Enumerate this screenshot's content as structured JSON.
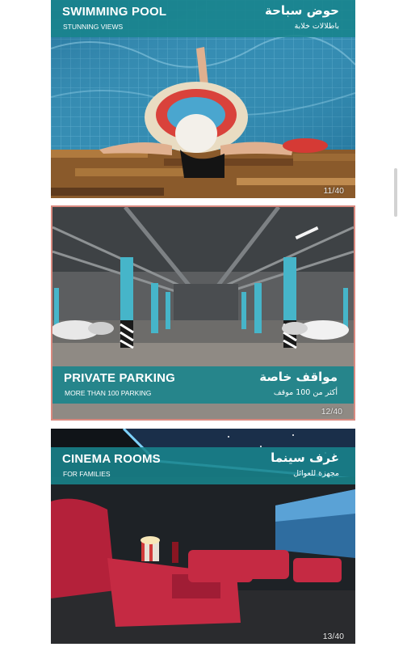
{
  "slides": [
    {
      "title_en": "SWIMMING POOL",
      "subtitle_en": "STUNNING VIEWS",
      "title_ar": "حوض سباحة",
      "subtitle_ar": "باطلالات خلابة",
      "counter": "11/40"
    },
    {
      "title_en": "PRIVATE PARKING",
      "subtitle_en": "MORE THAN 100 PARKING",
      "title_ar": "مواقف خاصة",
      "subtitle_ar": "أكثر من 100 موقف",
      "counter": "12/40"
    },
    {
      "title_en": "CINEMA ROOMS",
      "subtitle_en": "FOR FAMILIES",
      "title_ar": "غرف سينما",
      "subtitle_ar": "مجهزة للعوائل",
      "counter": "13/40"
    }
  ],
  "colors": {
    "banner_teal": "#18848c",
    "selected_border": "#d9897f"
  }
}
